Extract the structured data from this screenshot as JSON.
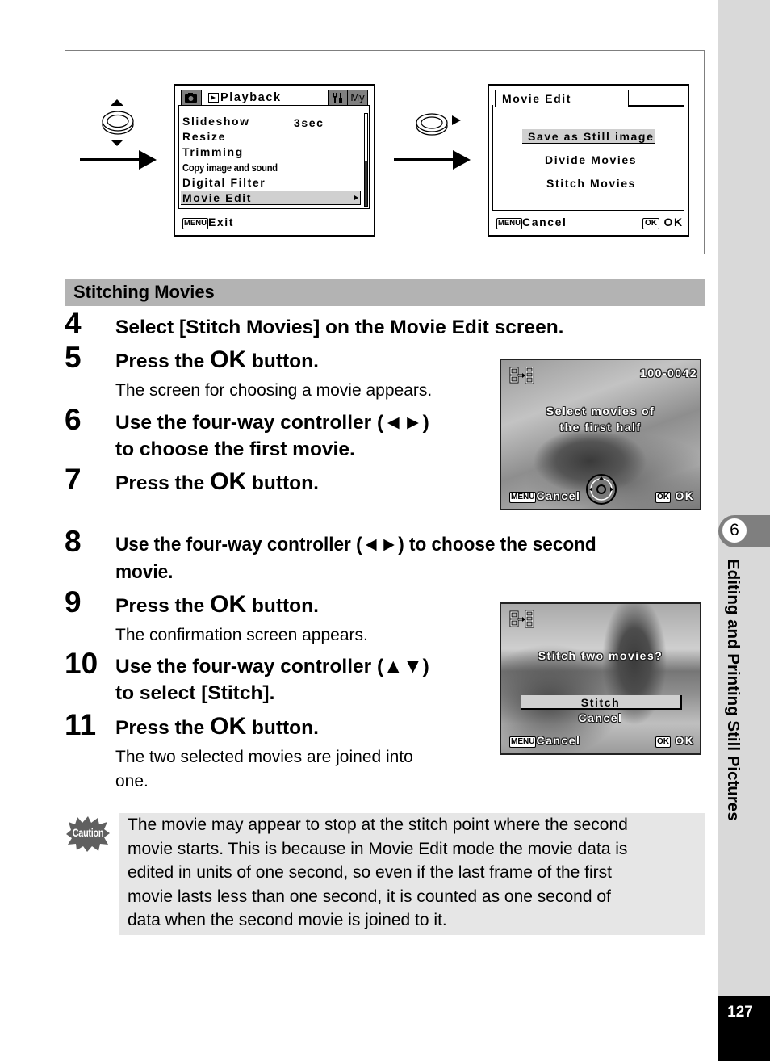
{
  "sidebar": {
    "chapter_number": "6",
    "chapter_title": "Editing and Printing Still Pictures",
    "page_number": "127"
  },
  "figure": {
    "dial_left_icon": "four-way-controller-up-down-icon",
    "dial_right_icon": "four-way-controller-right-icon",
    "playback_menu": {
      "camera_tab_icon": "camera-icon",
      "playback_tab_label": "Playback",
      "playback_tab_icon": "play-icon",
      "settings_tab_icon": "wrench-icon",
      "my_tab_label": "My",
      "items": [
        {
          "label": "Slideshow",
          "value": "3sec"
        },
        {
          "label": "Resize",
          "value": ""
        },
        {
          "label": "Trimming",
          "value": ""
        },
        {
          "label": "Copy image and sound",
          "value": ""
        },
        {
          "label": "Digital Filter",
          "value": ""
        },
        {
          "label": "Movie Edit",
          "value": "",
          "selected": true
        }
      ],
      "footer_key": "MENU",
      "footer_label": "Exit"
    },
    "movie_edit_menu": {
      "title": "Movie Edit",
      "items": [
        {
          "label": "Save as Still image",
          "selected": true
        },
        {
          "label": "Divide Movies",
          "selected": false
        },
        {
          "label": "Stitch Movies",
          "selected": false
        }
      ],
      "footer_cancel_key": "MENU",
      "footer_cancel_label": "Cancel",
      "footer_ok_key": "OK",
      "footer_ok_label": "OK"
    }
  },
  "section": {
    "title": "Stitching Movies"
  },
  "steps": [
    {
      "num": "4",
      "text": "Select [Stitch Movies] on the Movie Edit screen."
    },
    {
      "num": "5",
      "pre": "Press the ",
      "ok": "OK",
      "post": " button.",
      "desc": "The screen for choosing a movie appears."
    },
    {
      "num": "6",
      "line1": "Use the four-way controller (◄►)",
      "line2": "to choose the first movie."
    },
    {
      "num": "7",
      "pre": "Press the ",
      "ok": "OK",
      "post": " button."
    },
    {
      "num": "8",
      "line1": "Use the four-way controller (◄►) to choose the second",
      "line2": "movie."
    },
    {
      "num": "9",
      "pre": "Press the ",
      "ok": "OK",
      "post": " button.",
      "desc": "The confirmation screen appears."
    },
    {
      "num": "10",
      "line1": "Use the four-way controller (▲▼)",
      "line2": "to select [Stitch]."
    },
    {
      "num": "11",
      "pre": "Press the ",
      "ok": "OK",
      "post": " button.",
      "desc1": "The two selected movies are joined into",
      "desc2": "one."
    }
  ],
  "screen_select": {
    "mode_icon": "stitch-movie-icon",
    "file_number": "100-0042",
    "message_line1": "Select movies of",
    "message_line2": "the first half",
    "controller_icon": "four-way-controller-icon",
    "cancel_key": "MENU",
    "cancel_label": "Cancel",
    "ok_key": "OK",
    "ok_label": "OK"
  },
  "screen_confirm": {
    "mode_icon": "stitch-movie-icon",
    "message": "Stitch two movies?",
    "options": [
      {
        "label": "Stitch",
        "selected": true
      },
      {
        "label": "Cancel",
        "selected": false
      }
    ],
    "cancel_key": "MENU",
    "cancel_label": "Cancel",
    "ok_key": "OK",
    "ok_label": "OK"
  },
  "caution": {
    "icon_label": "Caution",
    "lines": [
      "The movie may appear to stop at the stitch point where the second",
      "movie starts. This is because in Movie Edit mode the movie data is",
      "edited in units of one second, so even if the last frame of the first",
      "movie lasts less than one second, it is counted as one second of",
      "data when the second movie is joined to it."
    ]
  }
}
